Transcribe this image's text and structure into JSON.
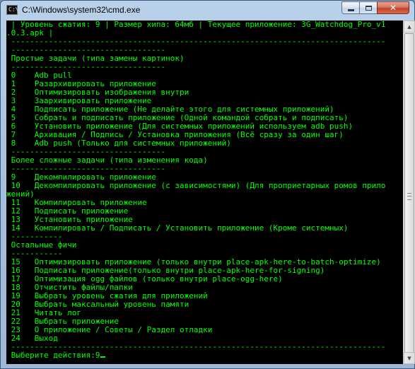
{
  "window": {
    "title": "C:\\Windows\\system32\\cmd.exe",
    "icon": "cmd-icon",
    "icon_glyph": "C:\\",
    "minimize_symbol": "",
    "close_symbol": "✕"
  },
  "console": {
    "lines": [
      " | Уровень сжатия: 9 | Размер хипа: 64мб | Текущее приложение: 3G_Watchdog_Pro_v1",
      ".0.3.apk |",
      " --------------------------------------------------------------------------------",
      " ---------------------------------",
      " Простые задачи (типа замены картинок)",
      " ---------------------------------",
      " 0    Adb pull",
      " 1    Разархивировать приложение",
      " 2    Оптимизировать изображения внутри",
      " 3    Заархивировать приложение",
      " 4    Подписать приложение (Не делайте этого для системных приложений)",
      " 5    Собрать и подписать приложение (Одной командой собрать и подписать)",
      " 6    Установить приложение (Для системных приложений используем adb push)",
      " 7    Архивация / Подпись / Установка приложения (Всё сразу за один шаг)",
      " 8    Adb push (Только для системных приложений)",
      " ---------------------------------",
      " Более сложные задачи (типа изменения кода)",
      " ---------------------------------",
      " 9    Декомпилировать приложение",
      " 10   Декомпилировать приложение (с зависимостями) (Для проприетарных ромов прило",
      "жений)",
      " 11   Компилировать приложение",
      " 12   Подписать приложение",
      " 13   Установить приложение",
      " 14   Компилировать / Подписать / Установить приложение (Кроме системных)",
      " -----------",
      " Остальные фичи",
      " -----------",
      " 15   Оптимизировать приложение (только внутри place-apk-here-to-batch-optimize)",
      " 16   Подписать приложение(только внутри place-apk-here-for-signing)",
      " 17   Оптимизация ogg файлов (только внутри place-ogg-here)",
      " 18   Отчистить файлы/папки",
      " 19   Выбрать уровень сжатия для приложений",
      " 20   Выбрать максальный уровень памяти",
      " 21   Читать лог",
      " 22   Выбрать приложение",
      " 23   О приложение / Советы / Раздел отладки",
      " 24   Выход",
      " --------------------------------------------------------------------------------",
      " Выберите действия:9"
    ]
  },
  "scrollbar": {
    "up_arrow": "▲",
    "down_arrow": "▼"
  },
  "colors": {
    "console_text": "#00ff00",
    "console_background": "#000000"
  }
}
